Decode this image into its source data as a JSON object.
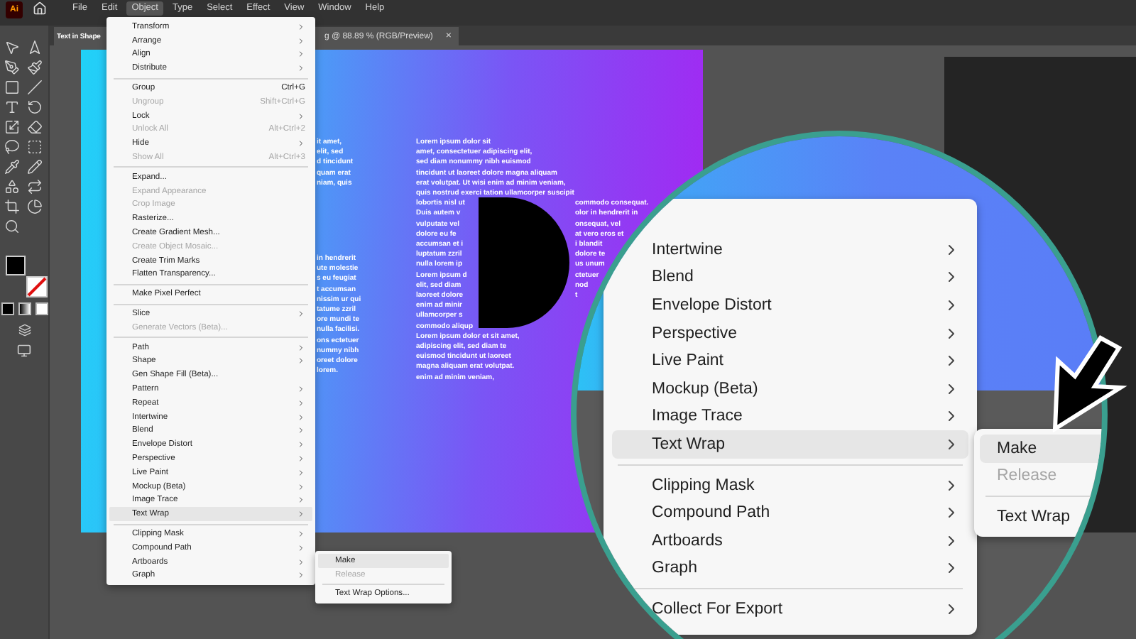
{
  "app_logo": "Ai",
  "menubar": {
    "items": [
      {
        "label": "File",
        "selected": false
      },
      {
        "label": "Edit",
        "selected": false
      },
      {
        "label": "Object",
        "selected": true
      },
      {
        "label": "Type",
        "selected": false
      },
      {
        "label": "Select",
        "selected": false
      },
      {
        "label": "Effect",
        "selected": false
      },
      {
        "label": "View",
        "selected": false
      },
      {
        "label": "Window",
        "selected": false
      },
      {
        "label": "Help",
        "selected": false
      }
    ]
  },
  "document_tab": {
    "title_start": "Text in Shape",
    "title_end": "g @ 88.89 % (RGB/Preview)",
    "close": "×"
  },
  "artboard": {
    "left_top_lines": [
      "it amet,",
      "elit, sed",
      "d tincidunt",
      "quam erat",
      "niam, quis"
    ],
    "left_bottom_lines": [
      "in hendrerit",
      "ute molestie",
      "s eu feugiat",
      "t accumsan",
      "nissim ur qui",
      "tatume zzril",
      "ore mundi te",
      "nulla facilisi.",
      "ons ectetuer",
      "nummy nibh",
      "oreet dolore",
      "lorem."
    ],
    "right_lines": [
      {
        "left": "Lorem ipsum dolor sit"
      },
      {
        "left": "amet, consectetuer adipiscing elit,"
      },
      {
        "left": "sed diam nonummy nibh euismod"
      },
      {
        "left": "tincidunt ut laoreet dolore magna aliquam"
      },
      {
        "left": "erat volutpat. Ut wisi enim ad minim veniam,"
      },
      {
        "left": "quis nostrud exerci tation ullamcorper suscipit"
      },
      {
        "left": "lobortis nisl ut",
        "right": "commodo consequat."
      },
      {
        "left": "Duis autem v",
        "right": "olor in hendrerit in"
      },
      {
        "left": "vulputate vel",
        "right": "onsequat, vel"
      },
      {
        "left": "dolore eu fe",
        "right": "at vero eros et"
      },
      {
        "left": "accumsan et i",
        "right": "i blandit"
      },
      {
        "left": "luptatum zzril",
        "right": "dolore te"
      },
      {
        "left": "nulla lorem ip",
        "right": "us unum"
      },
      {
        "left": "Lorem ipsum d",
        "right": "ctetuer"
      },
      {
        "left": "elit, sed diam",
        "right": "nod"
      },
      {
        "left": "laoreet dolore",
        "right": "t"
      },
      {
        "left": "enim ad minir"
      },
      {
        "left": "ullamcorper s"
      },
      {
        "left": "commodo aliqup"
      },
      {
        "left": "Lorem ipsum dolor et sit amet,"
      },
      {
        "left": "adipiscing elit, sed diam te"
      },
      {
        "left": "euismod tincidunt ut laoreet"
      },
      {
        "left": "magna aliquam erat volutpat."
      },
      {
        "left": "enim ad minim veniam,"
      }
    ]
  },
  "object_menu": {
    "items": [
      {
        "kind": "item",
        "label": "Transform",
        "submenu": true,
        "disabled": false,
        "highlighted": false
      },
      {
        "kind": "item",
        "label": "Arrange",
        "submenu": true,
        "disabled": false,
        "highlighted": false
      },
      {
        "kind": "item",
        "label": "Align",
        "submenu": true,
        "disabled": false,
        "highlighted": false
      },
      {
        "kind": "item",
        "label": "Distribute",
        "submenu": true,
        "disabled": false,
        "highlighted": false
      },
      {
        "kind": "separator"
      },
      {
        "kind": "item",
        "label": "Group",
        "shortcut": "Ctrl+G",
        "submenu": false,
        "disabled": false,
        "highlighted": false
      },
      {
        "kind": "item",
        "label": "Ungroup",
        "shortcut": "Shift+Ctrl+G",
        "submenu": false,
        "disabled": true,
        "highlighted": false
      },
      {
        "kind": "item",
        "label": "Lock",
        "submenu": true,
        "disabled": false,
        "highlighted": false
      },
      {
        "kind": "item",
        "label": "Unlock All",
        "shortcut": "Alt+Ctrl+2",
        "submenu": false,
        "disabled": true,
        "highlighted": false
      },
      {
        "kind": "item",
        "label": "Hide",
        "submenu": true,
        "disabled": false,
        "highlighted": false
      },
      {
        "kind": "item",
        "label": "Show All",
        "shortcut": "Alt+Ctrl+3",
        "submenu": false,
        "disabled": true,
        "highlighted": false
      },
      {
        "kind": "separator"
      },
      {
        "kind": "item",
        "label": "Expand...",
        "submenu": false,
        "disabled": false,
        "highlighted": false
      },
      {
        "kind": "item",
        "label": "Expand Appearance",
        "submenu": false,
        "disabled": true,
        "highlighted": false
      },
      {
        "kind": "item",
        "label": "Crop Image",
        "submenu": false,
        "disabled": true,
        "highlighted": false
      },
      {
        "kind": "item",
        "label": "Rasterize...",
        "submenu": false,
        "disabled": false,
        "highlighted": false
      },
      {
        "kind": "item",
        "label": "Create Gradient Mesh...",
        "submenu": false,
        "disabled": false,
        "highlighted": false
      },
      {
        "kind": "item",
        "label": "Create Object Mosaic...",
        "submenu": false,
        "disabled": true,
        "highlighted": false
      },
      {
        "kind": "item",
        "label": "Create Trim Marks",
        "submenu": false,
        "disabled": false,
        "highlighted": false
      },
      {
        "kind": "item",
        "label": "Flatten Transparency...",
        "submenu": false,
        "disabled": false,
        "highlighted": false
      },
      {
        "kind": "separator"
      },
      {
        "kind": "item",
        "label": "Make Pixel Perfect",
        "submenu": false,
        "disabled": false,
        "highlighted": false
      },
      {
        "kind": "separator"
      },
      {
        "kind": "item",
        "label": "Slice",
        "submenu": true,
        "disabled": false,
        "highlighted": false
      },
      {
        "kind": "item",
        "label": "Generate Vectors (Beta)...",
        "submenu": false,
        "disabled": true,
        "highlighted": false
      },
      {
        "kind": "separator"
      },
      {
        "kind": "item",
        "label": "Path",
        "submenu": true,
        "disabled": false,
        "highlighted": false
      },
      {
        "kind": "item",
        "label": "Shape",
        "submenu": true,
        "disabled": false,
        "highlighted": false
      },
      {
        "kind": "item",
        "label": "Gen Shape Fill (Beta)...",
        "submenu": false,
        "disabled": false,
        "highlighted": false
      },
      {
        "kind": "item",
        "label": "Pattern",
        "submenu": true,
        "disabled": false,
        "highlighted": false
      },
      {
        "kind": "item",
        "label": "Repeat",
        "submenu": true,
        "disabled": false,
        "highlighted": false
      },
      {
        "kind": "item",
        "label": "Intertwine",
        "submenu": true,
        "disabled": false,
        "highlighted": false
      },
      {
        "kind": "item",
        "label": "Blend",
        "submenu": true,
        "disabled": false,
        "highlighted": false
      },
      {
        "kind": "item",
        "label": "Envelope Distort",
        "submenu": true,
        "disabled": false,
        "highlighted": false
      },
      {
        "kind": "item",
        "label": "Perspective",
        "submenu": true,
        "disabled": false,
        "highlighted": false
      },
      {
        "kind": "item",
        "label": "Live Paint",
        "submenu": true,
        "disabled": false,
        "highlighted": false
      },
      {
        "kind": "item",
        "label": "Mockup (Beta)",
        "submenu": true,
        "disabled": false,
        "highlighted": false
      },
      {
        "kind": "item",
        "label": "Image Trace",
        "submenu": true,
        "disabled": false,
        "highlighted": false
      },
      {
        "kind": "item",
        "label": "Text Wrap",
        "submenu": true,
        "disabled": false,
        "highlighted": true
      },
      {
        "kind": "separator"
      },
      {
        "kind": "item",
        "label": "Clipping Mask",
        "submenu": true,
        "disabled": false,
        "highlighted": false
      },
      {
        "kind": "item",
        "label": "Compound Path",
        "submenu": true,
        "disabled": false,
        "highlighted": false
      },
      {
        "kind": "item",
        "label": "Artboards",
        "submenu": true,
        "disabled": false,
        "highlighted": false
      },
      {
        "kind": "item",
        "label": "Graph",
        "submenu": true,
        "disabled": false,
        "highlighted": false
      }
    ]
  },
  "text_wrap_submenu": {
    "items": [
      {
        "kind": "item",
        "label": "Make",
        "disabled": false,
        "highlighted": true
      },
      {
        "kind": "item",
        "label": "Release",
        "disabled": true,
        "highlighted": false
      },
      {
        "kind": "separator"
      },
      {
        "kind": "item",
        "label": "Text Wrap Options...",
        "disabled": false,
        "highlighted": false
      }
    ]
  },
  "magnifier": {
    "menu": {
      "items": [
        {
          "kind": "item",
          "label": "Intertwine",
          "submenu": true,
          "disabled": false,
          "highlighted": false
        },
        {
          "kind": "item",
          "label": "Blend",
          "submenu": true,
          "disabled": false,
          "highlighted": false
        },
        {
          "kind": "item",
          "label": "Envelope Distort",
          "submenu": true,
          "disabled": false,
          "highlighted": false
        },
        {
          "kind": "item",
          "label": "Perspective",
          "submenu": true,
          "disabled": false,
          "highlighted": false
        },
        {
          "kind": "item",
          "label": "Live Paint",
          "submenu": true,
          "disabled": false,
          "highlighted": false
        },
        {
          "kind": "item",
          "label": "Mockup (Beta)",
          "submenu": true,
          "disabled": false,
          "highlighted": false
        },
        {
          "kind": "item",
          "label": "Image Trace",
          "submenu": true,
          "disabled": false,
          "highlighted": false
        },
        {
          "kind": "item",
          "label": "Text Wrap",
          "submenu": true,
          "disabled": false,
          "highlighted": true
        },
        {
          "kind": "separator"
        },
        {
          "kind": "item",
          "label": "Clipping Mask",
          "submenu": true,
          "disabled": false,
          "highlighted": false
        },
        {
          "kind": "item",
          "label": "Compound Path",
          "submenu": true,
          "disabled": false,
          "highlighted": false
        },
        {
          "kind": "item",
          "label": "Artboards",
          "submenu": true,
          "disabled": false,
          "highlighted": false
        },
        {
          "kind": "item",
          "label": "Graph",
          "submenu": true,
          "disabled": false,
          "highlighted": false
        },
        {
          "kind": "separator"
        },
        {
          "kind": "item",
          "label": "Collect For Export",
          "submenu": true,
          "disabled": false,
          "highlighted": false
        }
      ]
    },
    "submenu": {
      "items": [
        {
          "kind": "item",
          "label": "Make",
          "disabled": false,
          "highlighted": true
        },
        {
          "kind": "item",
          "label": "Release",
          "disabled": true,
          "highlighted": false
        },
        {
          "kind": "separator"
        },
        {
          "kind": "item",
          "label": "Text Wrap",
          "disabled": false,
          "highlighted": false
        }
      ]
    }
  }
}
